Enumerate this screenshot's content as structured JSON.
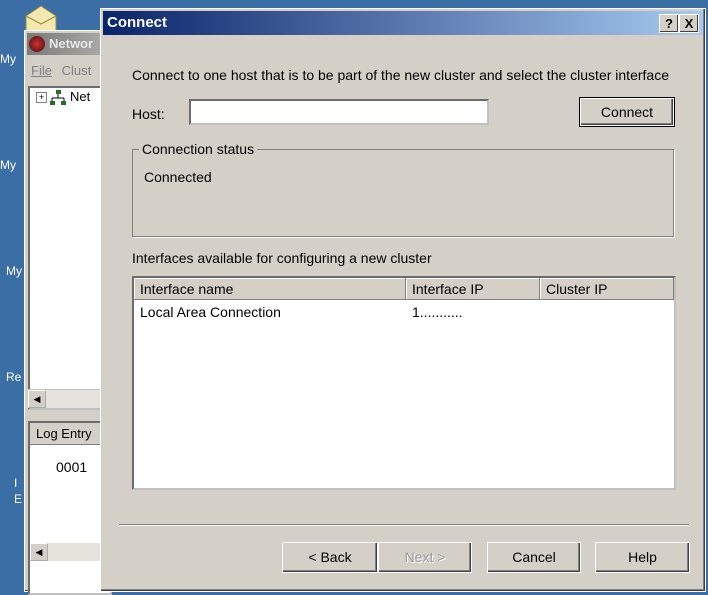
{
  "desktop": {
    "labels": [
      "My",
      "My",
      "My",
      "Re",
      "I",
      "E"
    ]
  },
  "background_window": {
    "title": "Networ",
    "menu": [
      "File",
      "Clust"
    ],
    "tree_item": "Net",
    "log_header": "Log Entry",
    "log_value": "0001"
  },
  "dialog": {
    "title": "Connect",
    "help_button": "?",
    "close_button": "X",
    "instruction": "Connect to one host that is to be part of the new cluster and select the cluster interface",
    "host_label": "Host:",
    "host_value": "",
    "connect_button": "Connect",
    "connection_status": {
      "title": "Connection status",
      "text": "Connected"
    },
    "interfaces_label": "Interfaces available for configuring a new cluster",
    "table": {
      "columns": [
        "Interface name",
        "Interface IP",
        "Cluster IP"
      ],
      "rows": [
        {
          "name": "Local Area Connection",
          "ip": "1...........",
          "cluster_ip": ""
        }
      ]
    },
    "buttons": {
      "back": "< Back",
      "next": "Next >",
      "cancel": "Cancel",
      "help": "Help"
    }
  }
}
